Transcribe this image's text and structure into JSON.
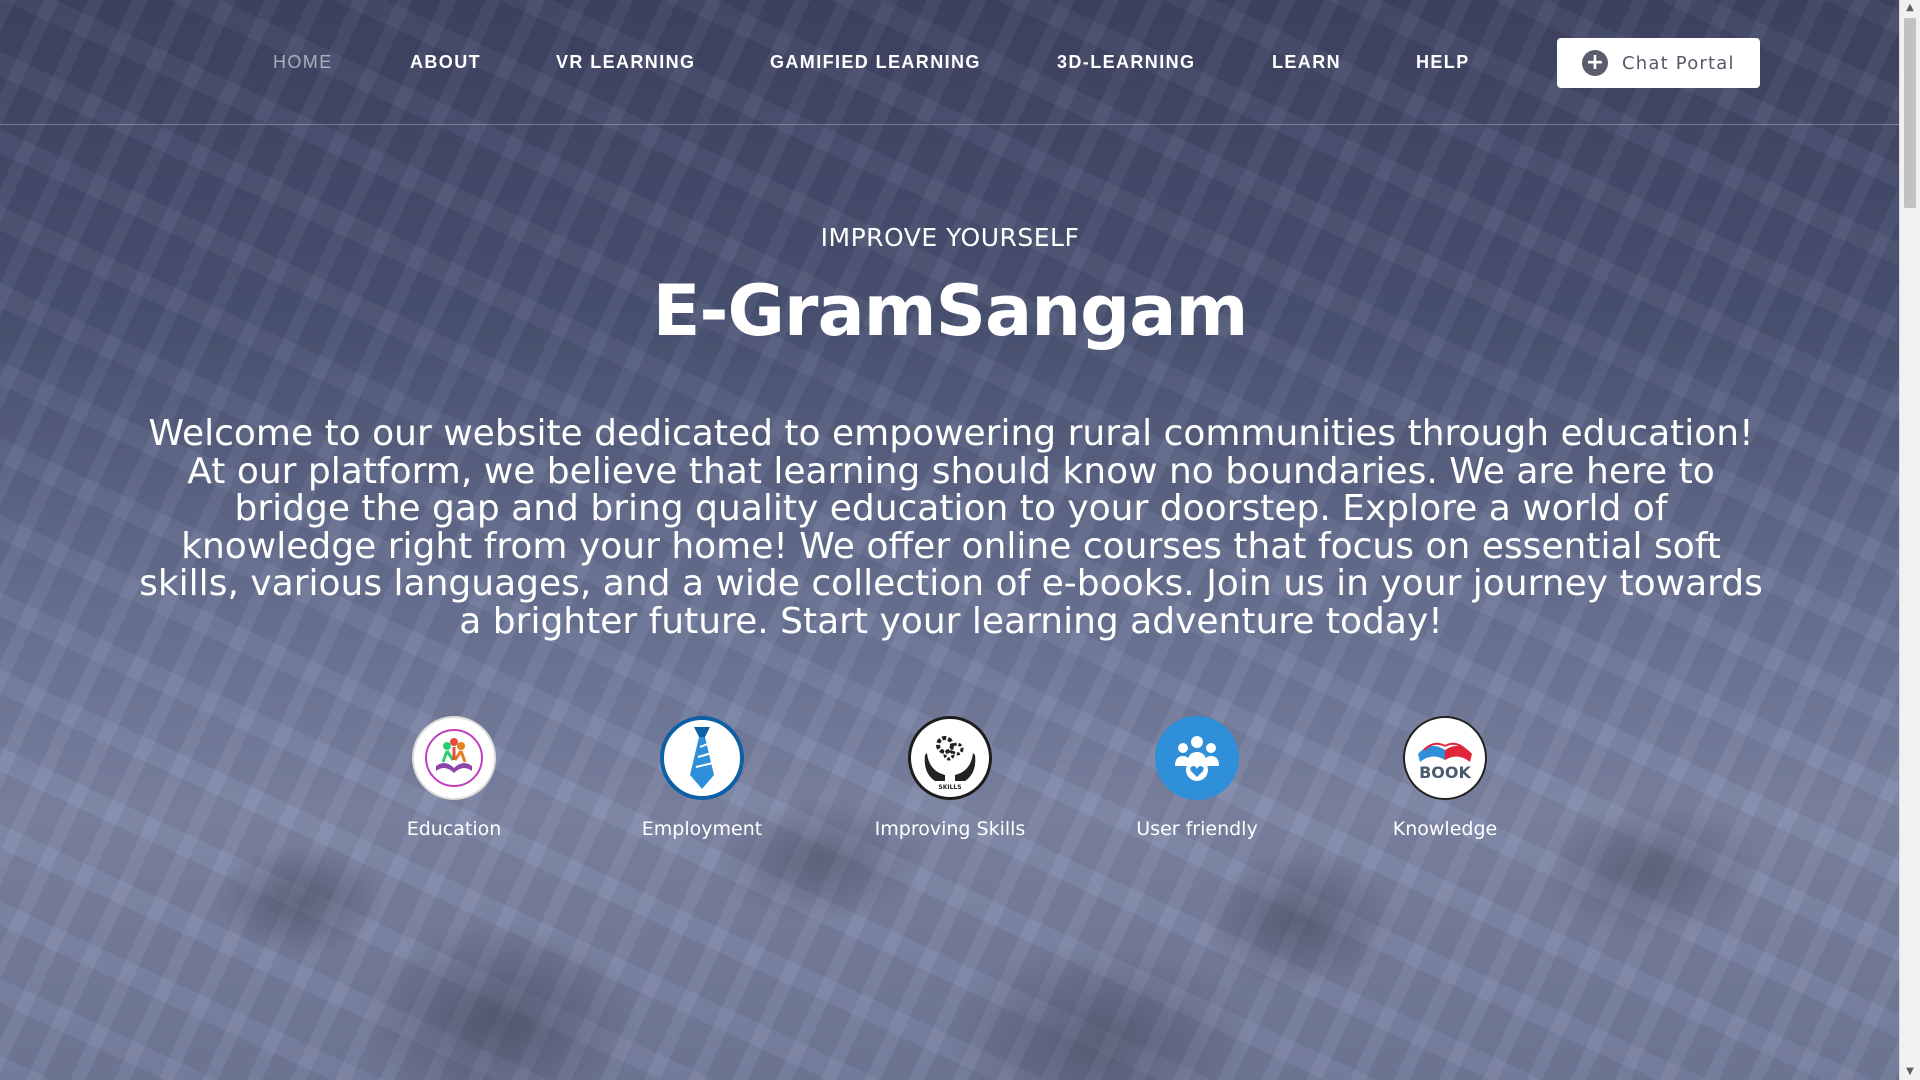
{
  "nav": {
    "items": [
      {
        "label": "HOME",
        "active": true
      },
      {
        "label": "ABOUT"
      },
      {
        "label": "VR LEARNING"
      },
      {
        "label": "GAMIFIED LEARNING"
      },
      {
        "label": "3D-LEARNING"
      },
      {
        "label": "LEARN"
      },
      {
        "label": "HELP"
      }
    ],
    "chat_button": {
      "label": "Chat Portal",
      "icon": "plus-circle-icon"
    }
  },
  "hero": {
    "tagline": "IMPROVE YOURSELF",
    "title": "E-GramSangam",
    "description": "Welcome to our website dedicated to empowering rural communities through education! At our platform, we believe that learning should know no boundaries. We are here to bridge the gap and bring quality education to your doorstep. Explore a world of knowledge right from your home! We offer online courses that focus on essential soft skills, various languages, and a wide collection of e-books. Join us in your journey towards a brighter future. Start your learning adventure today!"
  },
  "features": [
    {
      "label": "Education",
      "icon": "education-icon"
    },
    {
      "label": "Employment",
      "icon": "tie-icon"
    },
    {
      "label": "Improving Skills",
      "icon": "skills-icon",
      "icon_text": "SKILLS"
    },
    {
      "label": "User friendly",
      "icon": "users-heart-icon"
    },
    {
      "label": "Knowledge",
      "icon": "book-icon",
      "icon_text": "BOOK"
    }
  ],
  "colors": {
    "chat_button_bg": "#ffffff",
    "employment_blue": "#0d5fa6",
    "user_friendly_blue": "#2f8fd8",
    "book_red": "#e0243a"
  }
}
